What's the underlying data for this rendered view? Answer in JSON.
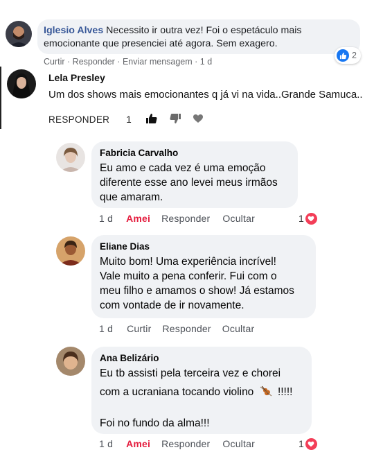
{
  "comments": [
    {
      "author": "Iglesio Alves",
      "text": "Necessito ir outra vez! Foi o espetáculo mais emocionante que presenciei até agora. Sem exagero.",
      "actions": {
        "like": "Curtir",
        "reply": "Responder",
        "message": "Enviar mensagem",
        "time": "1 d"
      },
      "reaction_count": "2"
    },
    {
      "author": "Lela Presley",
      "text": "Um dos shows mais emocionantes q já vi na vida..Grande Samuca..",
      "actions": {
        "reply": "RESPONDER",
        "like_count": "1"
      }
    }
  ],
  "replies": [
    {
      "author": "Fabricia Carvalho",
      "lines": [
        "Eu amo e cada vez é uma emoção",
        "diferente esse ano levei meus irmãos",
        "que amaram."
      ],
      "time": "1 d",
      "like": "Amei",
      "reply": "Responder",
      "hide": "Ocultar",
      "reaction_count": "1"
    },
    {
      "author": "Eliane Dias",
      "lines": [
        "Muito bom! Uma experiência incrível!",
        "Vale muito a pena conferir. Fui com o",
        "meu filho e amamos o show! Já estamos",
        "com vontade de ir novamente."
      ],
      "time": "1 d",
      "like": "Curtir",
      "reply": "Responder",
      "hide": "Ocultar"
    },
    {
      "author": "Ana Belizário",
      "lines": [
        "Eu tb assisti pela terceira vez e chorei",
        "com a ucraniana tocando violino",
        "",
        "Foi no fundo da alma!!!"
      ],
      "violin_emoji_suffix": "!!!!!",
      "time": "1 d",
      "like": "Amei",
      "reply": "Responder",
      "hide": "Ocultar",
      "reaction_count": "1"
    }
  ],
  "colors": {
    "link": "#385898",
    "bubble": "#f0f2f5",
    "love": "#e41e3f",
    "like_blue": "#1877f2"
  }
}
